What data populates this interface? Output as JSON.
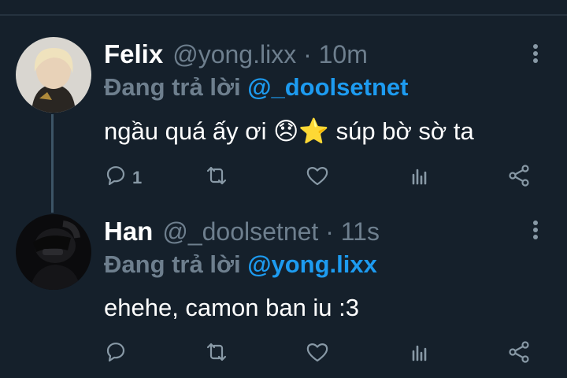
{
  "tweets": [
    {
      "name": "Felix",
      "handle": "@yong.lixx · 10m",
      "replying_prefix": "Đang trả lời",
      "replying_to": "@_doolsetnet",
      "text": "ngầu quá ấy ơi 😞⭐ súp bờ sờ ta",
      "reply_count": "1"
    },
    {
      "name": "Han",
      "handle": "@_doolsetnet · 11s",
      "replying_prefix": "Đang trả lời",
      "replying_to": "@yong.lixx",
      "text": "ehehe, camon ban iu :3",
      "reply_count": ""
    }
  ],
  "icons": [
    "reply-icon",
    "retweet-icon",
    "like-icon",
    "analytics-icon",
    "share-icon",
    "more-icon"
  ],
  "colors": {
    "background": "#15202b",
    "accent": "#1d9bf0",
    "secondary_text": "#6e7f8e",
    "icon": "#8899a6"
  }
}
